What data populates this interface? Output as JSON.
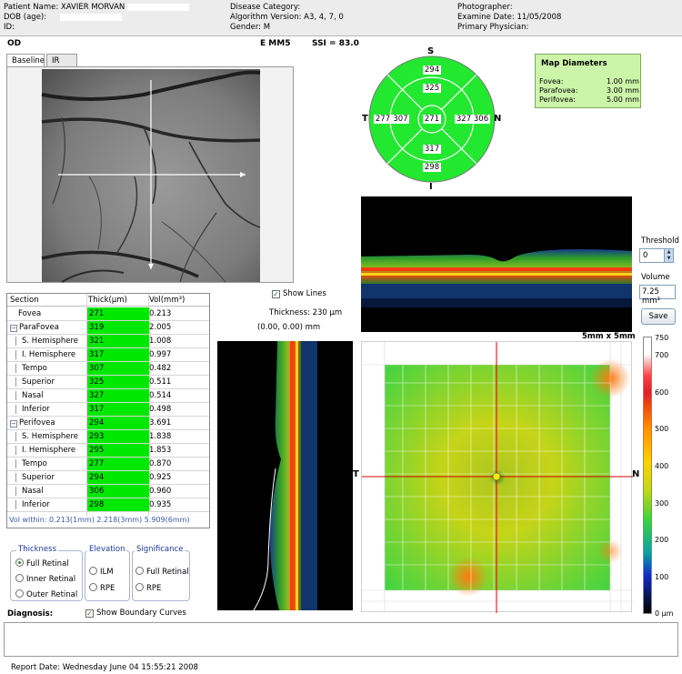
{
  "header": {
    "patient_name": "Patient Name: XAVIER  MORVAN",
    "dob": "DOB (age):",
    "id": "ID:",
    "disease_category": "Disease Category:",
    "algorithm_version": "Algorithm Version: A3, 4, 7, 0",
    "gender": "Gender: M",
    "photographer": "Photographer:",
    "examine_date": "Examine Date: 11/05/2008",
    "primary_physician": "Primary Physician:"
  },
  "scan": {
    "eye": "OD",
    "protocol": "E MM5",
    "ssi": "SSI = 83.0"
  },
  "tabs": [
    "Baseline",
    "IR"
  ],
  "sector_map": {
    "superior_label": "S",
    "inferior_label": "I",
    "temporal_label": "T",
    "nasal_label": "N",
    "center": "271",
    "inner_superior": "325",
    "inner_inferior": "317",
    "inner_temporal": "307",
    "inner_nasal": "327",
    "outer_superior": "294",
    "outer_inferior": "298",
    "outer_temporal": "277",
    "outer_nasal": "306",
    "fill_color": "#22e830"
  },
  "map_diameters": {
    "title": "Map Diameters",
    "rows": [
      {
        "name": "Fovea:",
        "value": "1.00 mm"
      },
      {
        "name": "Parafovea:",
        "value": "3.00 mm"
      },
      {
        "name": "Perifovea:",
        "value": "5.00 mm"
      }
    ]
  },
  "controls": {
    "threshold_label": "Threshold",
    "threshold_value": "0",
    "volume_label": "Volume",
    "volume_value": "7.25 mm³",
    "save_label": "Save",
    "show_lines": "Show Lines",
    "thickness_readout": "Thickness: 230 µm",
    "coord_readout": "(0.00, 0.00) mm",
    "show_boundary": "Show Boundary Curves",
    "scan_size": "5mm x 5mm"
  },
  "table": {
    "headers": [
      "Section",
      "Thick(µm)",
      "Vol(mm³)"
    ],
    "rows": [
      {
        "section": "Fovea",
        "thick": "271",
        "vol": "0.213",
        "level": 1,
        "group": false
      },
      {
        "section": "ParaFovea",
        "thick": "319",
        "vol": "2.005",
        "level": 0,
        "group": true
      },
      {
        "section": "S. Hemisphere",
        "thick": "321",
        "vol": "1.008",
        "level": 1,
        "group": false
      },
      {
        "section": "I. Hemisphere",
        "thick": "317",
        "vol": "0.997",
        "level": 1,
        "group": false
      },
      {
        "section": "Tempo",
        "thick": "307",
        "vol": "0.482",
        "level": 1,
        "group": false
      },
      {
        "section": "Superior",
        "thick": "325",
        "vol": "0.511",
        "level": 1,
        "group": false
      },
      {
        "section": "Nasal",
        "thick": "327",
        "vol": "0.514",
        "level": 1,
        "group": false
      },
      {
        "section": "Inferior",
        "thick": "317",
        "vol": "0.498",
        "level": 1,
        "group": false
      },
      {
        "section": "Perifovea",
        "thick": "294",
        "vol": "3.691",
        "level": 0,
        "group": true
      },
      {
        "section": "S. Hemisphere",
        "thick": "293",
        "vol": "1.838",
        "level": 1,
        "group": false
      },
      {
        "section": "I. Hemisphere",
        "thick": "295",
        "vol": "1.853",
        "level": 1,
        "group": false
      },
      {
        "section": "Tempo",
        "thick": "277",
        "vol": "0.870",
        "level": 1,
        "group": false
      },
      {
        "section": "Superior",
        "thick": "294",
        "vol": "0.925",
        "level": 1,
        "group": false
      },
      {
        "section": "Nasal",
        "thick": "306",
        "vol": "0.960",
        "level": 1,
        "group": false
      },
      {
        "section": "Inferior",
        "thick": "298",
        "vol": "0.935",
        "level": 1,
        "group": false
      }
    ],
    "footer": "Vol within: 0.213(1mm) 2.218(3mm) 5.909(6mm)"
  },
  "thickness_group": {
    "title": "Thickness",
    "options": [
      "Full Retinal",
      "Inner Retinal",
      "Outer Retinal"
    ],
    "selected": "Full Retinal"
  },
  "elevation_group": {
    "title": "Elevation",
    "options": [
      "ILM",
      "RPE"
    ]
  },
  "significance_group": {
    "title": "Significance",
    "options": [
      "Full Retinal",
      "RPE"
    ]
  },
  "thickness_map": {
    "left_label": "T",
    "right_label": "N"
  },
  "colorbar": {
    "ticks": [
      "750",
      "700",
      "600",
      "500",
      "400",
      "300",
      "200",
      "100",
      "0 µm"
    ]
  },
  "diagnosis_label": "Diagnosis:",
  "report_date": "Report Date: Wednesday June 04 15:55:21 2008"
}
